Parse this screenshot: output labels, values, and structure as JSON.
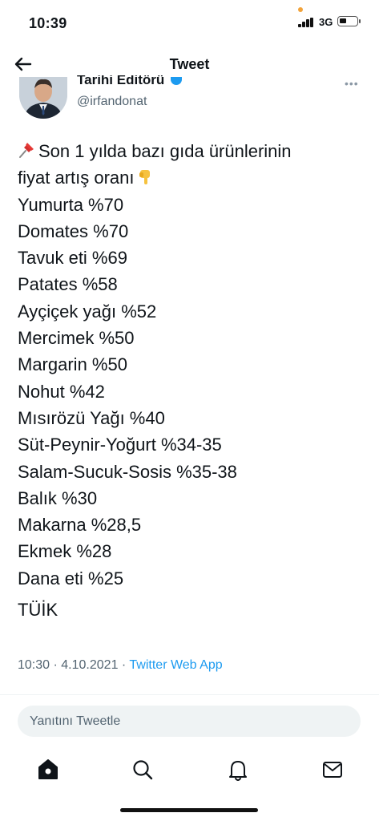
{
  "status_bar": {
    "time": "10:39",
    "network": "3G"
  },
  "nav": {
    "title": "Tweet"
  },
  "author": {
    "name": "Tarihi Editörü",
    "handle": "@irfandonat"
  },
  "tweet": {
    "intro_line1": "Son 1 yılda bazı gıda ürünlerinin",
    "intro_line2": "fiyat artış oranı",
    "items": [
      "Yumurta %70",
      "Domates %70",
      "Tavuk eti %69",
      "Patates %58",
      "Ayçiçek yağı %52",
      "Mercimek %50",
      "Margarin %50",
      "Nohut %42",
      "Mısırözü Yağı %40",
      "Süt-Peynir-Yoğurt %34-35",
      "Salam-Sucuk-Sosis %35-38",
      "Balık %30",
      "Makarna %28,5",
      "Ekmek %28",
      "Dana eti %25"
    ],
    "source": "TÜİK",
    "time": "10:30",
    "separator": "·",
    "date": "4.10.2021",
    "app": "Twitter Web App"
  },
  "reply": {
    "placeholder": "Yanıtını Tweetle"
  },
  "tabs": [
    {
      "name": "home-icon"
    },
    {
      "name": "search-icon"
    },
    {
      "name": "bell-icon"
    },
    {
      "name": "mail-icon"
    }
  ],
  "colors": {
    "accent": "#1d9bf0",
    "secondary_text": "#536471",
    "reply_bg": "#eff3f4"
  }
}
